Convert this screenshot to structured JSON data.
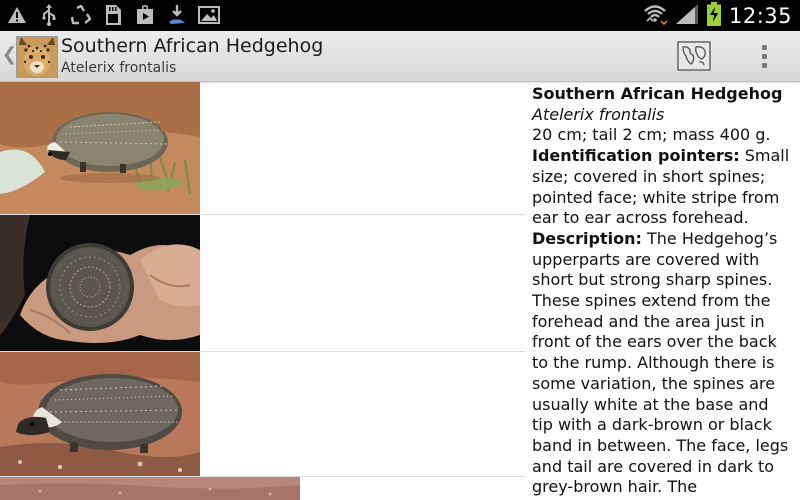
{
  "status_bar": {
    "time": "12:35",
    "left_icons": [
      "warning-icon",
      "usb-icon",
      "recycle-icon",
      "sd-card-icon",
      "play-store-icon",
      "download-icon",
      "gallery-icon"
    ],
    "right_icons": [
      "wifi-icon",
      "signal-icon",
      "battery-charging-icon"
    ]
  },
  "action_bar": {
    "title": "Southern African Hedgehog",
    "subtitle": "Atelerix frontalis",
    "map_icon": "map-icon",
    "overflow_icon": "overflow-menu-icon"
  },
  "species": {
    "name": "Southern African Hedgehog",
    "scientific_name": "Atelerix frontalis",
    "measurements": "20 cm; tail 2 cm; mass 400 g.",
    "id_label": "Identification pointers:",
    "id_text": " Small size; covered in short spines; pointed face; white stripe from ear to ear across forehead.",
    "desc_label": "Description:",
    "desc_text": " The Hedgehog’s upperparts are covered with short but strong sharp spines. These spines extend from the forehead and the area just in front of the ears over the back to the rump. Although there is some variation, the spines are usually white at the base and tip with a dark-brown or black band in between. The face, legs and tail are covered in dark to grey-brown hair. The"
  },
  "gallery": {
    "photos": [
      "hedgehog-walking-photo",
      "hedgehog-in-hands-photo",
      "hedgehog-side-photo",
      "ground-photo"
    ]
  }
}
